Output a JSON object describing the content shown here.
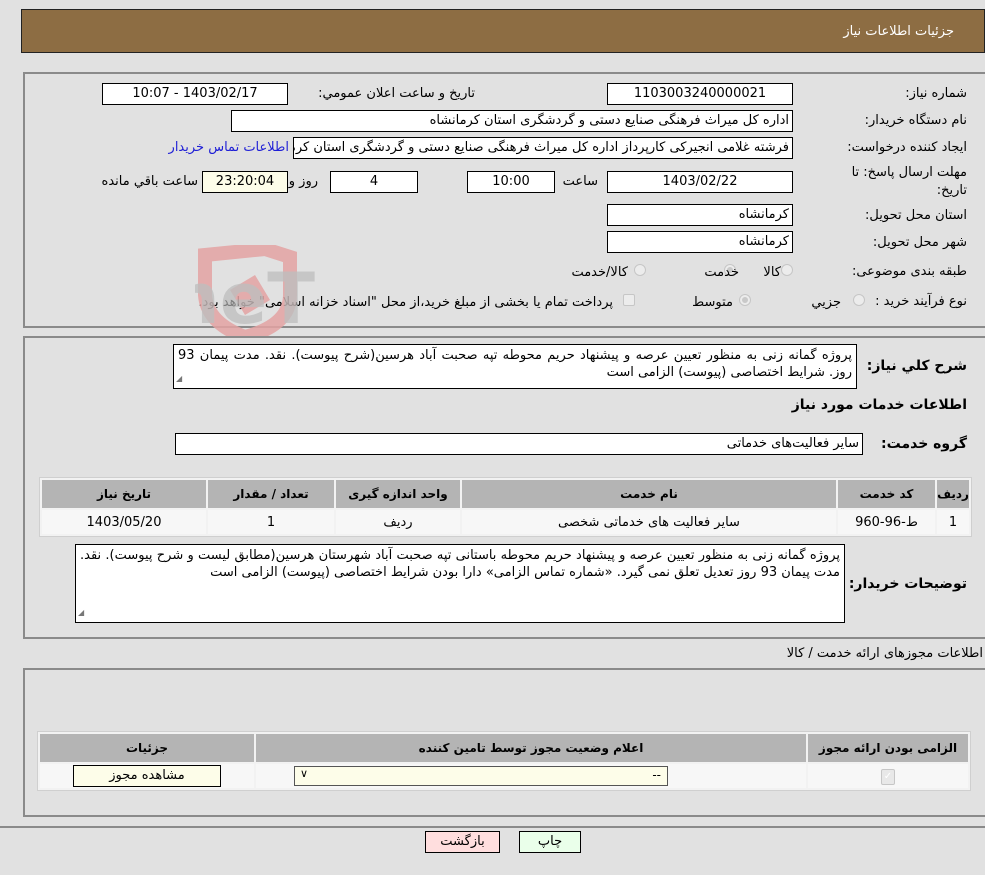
{
  "header": {
    "title": "جزئیات اطلاعات نیاز"
  },
  "details": {
    "need_number_label": "شماره نیاز:",
    "need_number": "1103003240000021",
    "announce_label": "تاریخ و ساعت اعلان عمومي:",
    "announce_value": "1403/02/17 - 10:07",
    "buyer_org_label": "نام دستگاه خریدار:",
    "buyer_org": "اداره کل میراث فرهنگی  صنایع دستی و گردشگری استان کرمانشاه",
    "creator_label": "ایجاد کننده درخواست:",
    "creator": "فرشته غلامی انجیرکی کارپرداز اداره کل میراث فرهنگی  صنایع دستی و گردشگری استان کرمانشاه",
    "contact_link": "اطلاعات تماس خریدار",
    "deadline_label": "مهلت ارسال پاسخ: تا تاریخ:",
    "deadline_date": "1403/02/22",
    "time_label": "ساعت",
    "deadline_time": "10:00",
    "days_value": "4",
    "days_label": "روز و",
    "remaining_time": "23:20:04",
    "remaining_label": "ساعت باقي مانده",
    "province_label": "استان محل تحویل:",
    "province": "کرمانشاه",
    "city_label": "شهر محل تحویل:",
    "city": "کرمانشاه",
    "category_label": "طبقه بندی موضوعی:",
    "category_options": [
      {
        "label": "کالا",
        "selected": false
      },
      {
        "label": "خدمت",
        "selected": true
      },
      {
        "label": "کالا/خدمت",
        "selected": false
      }
    ],
    "process_label": "نوع فرآیند خرید :",
    "process_options": [
      {
        "label": "جزیي",
        "selected": false
      },
      {
        "label": "متوسط",
        "selected": true
      }
    ],
    "treasury_note": "پرداخت تمام یا بخشی از مبلغ خرید،از محل \"اسناد خزانه اسلامی\" خواهد بود.",
    "treasury_checked": false
  },
  "summary": {
    "label": "شرح کلي نیاز:",
    "text": "پروژه گمانه زنی به منظور تعیین عرصه و پیشنهاد حریم محوطه  تپه صحبت آباد  هرسین(شرح  پیوست). نقد. مدت پیمان 93 روز. شرایط اختصاصی (پیوست) الزامی است"
  },
  "services": {
    "section_title": "اطلاعات خدمات مورد نیاز",
    "group_label": "گروه خدمت:",
    "group_value": "سایر فعالیت‌های خدماتی",
    "columns": [
      "ردیف",
      "کد خدمت",
      "نام خدمت",
      "واحد اندازه گیری",
      "تعداد / مقدار",
      "تاریخ نیاز"
    ],
    "rows": [
      [
        "1",
        "ط-96-960",
        "سایر فعالیت های خدماتی شخصی",
        "ردیف",
        "1",
        "1403/05/20"
      ]
    ]
  },
  "buyer_notes": {
    "label": "توضیحات خریدار:",
    "text": "پروژه گمانه زنی به منظور تعیین عرصه و پیشنهاد حریم محوطه باستانی تپه صحبت آباد شهرستان هرسین(مطابق لیست و شرح  پیوست). نقد. مدت پیمان 93 روز تعدیل تعلق نمی گیرد. «شماره تماس الزامی» دارا بودن شرایط اختصاصی (پیوست) الزامی است"
  },
  "permits": {
    "section_title": "اطلاعات مجوزهای ارائه خدمت / کالا",
    "columns": [
      "الزامی بودن ارائه مجوز",
      "اعلام وضعیت مجوز توسط تامین کننده",
      "جزئیات"
    ],
    "row": {
      "required_checked": true,
      "status_value": "--",
      "details_button": "مشاهده مجوز"
    }
  },
  "footer": {
    "print_button": "چاپ",
    "back_button": "بازگشت"
  },
  "watermark": {
    "text": "AriaTender.neT"
  },
  "colors": {
    "header_bg": "#8d6d43",
    "print_bg": "#eaffea",
    "back_bg": "#ffdede",
    "link": "#1f1fd6"
  }
}
